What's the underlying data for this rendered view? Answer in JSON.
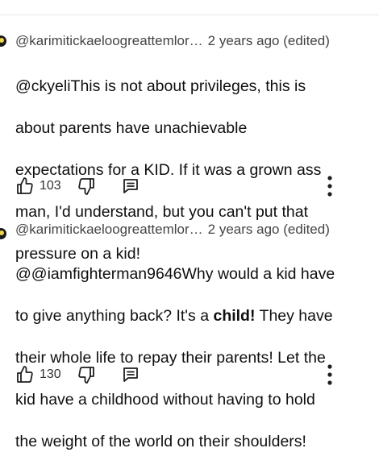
{
  "comments": [
    {
      "author": "@karimitickaeloogreattemlor…",
      "time": "2 years ago (edited)",
      "text_lines": [
        "@ckyeliThis is not about privileges, this is",
        "about parents have unachievable",
        "expectations for a KID. If it was a grown ass",
        "man, I'd understand, but you can't put that",
        "pressure on a kid!"
      ],
      "likes": "103",
      "actions": {
        "like": "thumbs-up-icon",
        "dislike": "thumbs-down-icon",
        "reply": "reply-comment-icon",
        "more": "more-vertical-icon"
      }
    },
    {
      "author": "@karimitickaeloogreattemlor…",
      "time": "2 years ago (edited)",
      "text_line1": "@@iamfighterman9646Why would a kid have",
      "text_line2_pre": "to give anything back? It's a ",
      "text_line2_bold": "child!",
      "text_line2_post": " They have",
      "text_lines_rest": [
        "their whole life to repay their parents! Let the",
        "kid have a childhood without having to hold",
        "the weight of the world on their shoulders!"
      ],
      "likes": "130",
      "actions": {
        "like": "thumbs-up-icon",
        "dislike": "thumbs-down-icon",
        "reply": "reply-comment-icon",
        "more": "more-vertical-icon"
      }
    }
  ],
  "colors": {
    "text": "#0f0f0f",
    "meta": "#444444",
    "icon": "#1f1f1f"
  }
}
